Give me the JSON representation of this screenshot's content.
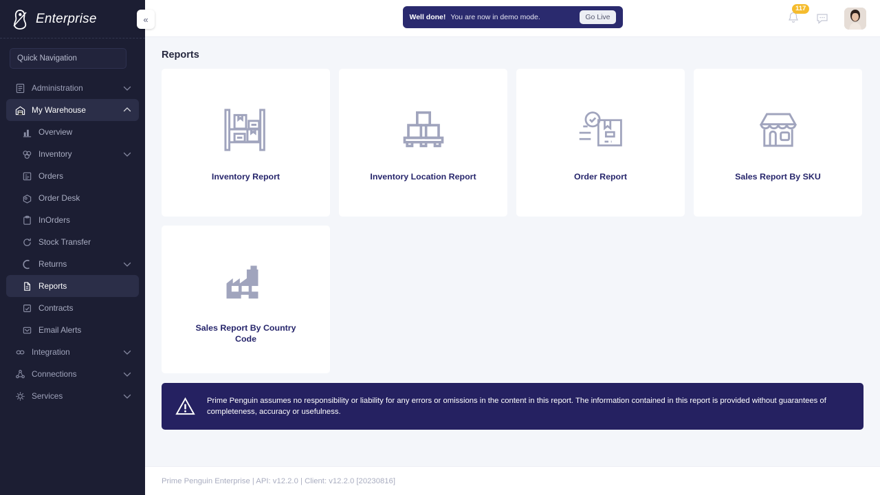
{
  "sidebar": {
    "brand": "Enterprise",
    "brand_logo_icon": "penguin-logo-icon",
    "collapse_label": "«",
    "quick_nav_placeholder": "Quick Navigation",
    "quick_nav_value": "",
    "items": [
      {
        "label": "Administration",
        "icon": "admin-list-icon",
        "level": "top",
        "active": false,
        "chevron": "down"
      },
      {
        "label": "My Warehouse",
        "icon": "warehouse-icon",
        "level": "top",
        "active": true,
        "chevron": "up"
      },
      {
        "label": "Overview",
        "icon": "bar-chart-icon",
        "level": "child",
        "active": false,
        "chevron": ""
      },
      {
        "label": "Inventory",
        "icon": "boxes-icon",
        "level": "child",
        "active": false,
        "chevron": "down"
      },
      {
        "label": "Orders",
        "icon": "orders-icon",
        "level": "child",
        "active": false,
        "chevron": ""
      },
      {
        "label": "Order Desk",
        "icon": "order-desk-icon",
        "level": "child",
        "active": false,
        "chevron": ""
      },
      {
        "label": "InOrders",
        "icon": "clipboard-icon",
        "level": "child",
        "active": false,
        "chevron": ""
      },
      {
        "label": "Stock Transfer",
        "icon": "refresh-icon",
        "level": "child",
        "active": false,
        "chevron": ""
      },
      {
        "label": "Returns",
        "icon": "return-arrow-icon",
        "level": "child",
        "active": false,
        "chevron": "down"
      },
      {
        "label": "Reports",
        "icon": "document-icon",
        "level": "child",
        "active": true,
        "chevron": ""
      },
      {
        "label": "Contracts",
        "icon": "contract-icon",
        "level": "child",
        "active": false,
        "chevron": ""
      },
      {
        "label": "Email Alerts",
        "icon": "email-alert-icon",
        "level": "child",
        "active": false,
        "chevron": ""
      },
      {
        "label": "Integration",
        "icon": "link-icon",
        "level": "top",
        "active": false,
        "chevron": "down"
      },
      {
        "label": "Connections",
        "icon": "connections-icon",
        "level": "top",
        "active": false,
        "chevron": "down"
      },
      {
        "label": "Services",
        "icon": "services-gear-icon",
        "level": "top",
        "active": false,
        "chevron": "down"
      }
    ]
  },
  "topbar": {
    "banner": {
      "strong": "Well done!",
      "message": "You are now in demo mode.",
      "button": "Go Live"
    },
    "notifications_count": "117",
    "bell_icon": "bell-icon",
    "chat_icon": "chat-bubble-icon",
    "avatar_icon": "user-avatar"
  },
  "page": {
    "title": "Reports",
    "cards": [
      {
        "title": "Inventory Report",
        "icon": "shelf-rack-boxes-icon"
      },
      {
        "title": "Inventory Location Report",
        "icon": "pallet-boxes-icon"
      },
      {
        "title": "Order Report",
        "icon": "package-check-icon"
      },
      {
        "title": "Sales Report By SKU",
        "icon": "storefront-icon"
      },
      {
        "title": "Sales Report By Country Code",
        "icon": "factory-icon"
      }
    ],
    "disclaimer": {
      "icon": "warning-triangle-icon",
      "text": "Prime Penguin assumes no responsibility or liability for any errors or omissions in the content in this report. The information contained in this report is provided without guarantees of completeness, accuracy or usefulness."
    },
    "footer": "Prime Penguin Enterprise | API: v12.2.0 | Client: v12.2.0 [20230816]"
  },
  "colors": {
    "sidebar_bg": "#1c1e33",
    "accent_navy": "#252161",
    "badge_yellow": "#f5bc2e",
    "card_title": "#26256b",
    "icon_gray": "#a0a4bd"
  }
}
